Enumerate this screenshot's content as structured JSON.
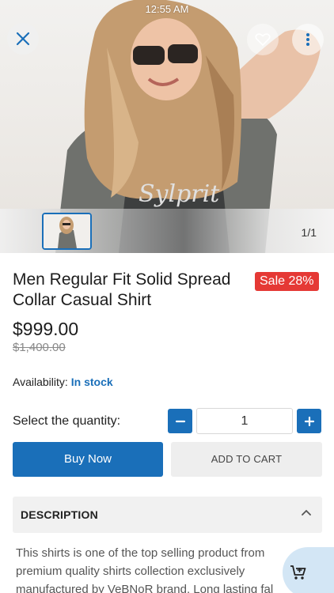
{
  "status_bar": {
    "time": "12:55 AM"
  },
  "gallery": {
    "page_indicator": "1/1"
  },
  "product": {
    "title": "Men Regular Fit Solid Spread Collar Casual Shirt",
    "sale_badge": "Sale 28%",
    "price": "$999.00",
    "old_price": "$1,400.00",
    "availability_label": "Availability:",
    "availability_value": "In stock"
  },
  "quantity": {
    "label": "Select the quantity:",
    "value": "1"
  },
  "actions": {
    "buy_now": "Buy Now",
    "add_to_cart": "ADD TO CART"
  },
  "description": {
    "header": "DESCRIPTION",
    "text": "This shirts is one of the top selling product from premium quality shirts collection exclusively manufactured by VeBNoR brand. Long lasting fal"
  },
  "icons": [
    "close-icon",
    "heart-icon",
    "more-vertical-icon",
    "minus-icon",
    "plus-icon",
    "chevron-up-icon",
    "add-to-cart-icon"
  ],
  "colors": {
    "accent": "#1a6fb9",
    "sale": "#e53935",
    "stock": "#1a6fb9"
  }
}
